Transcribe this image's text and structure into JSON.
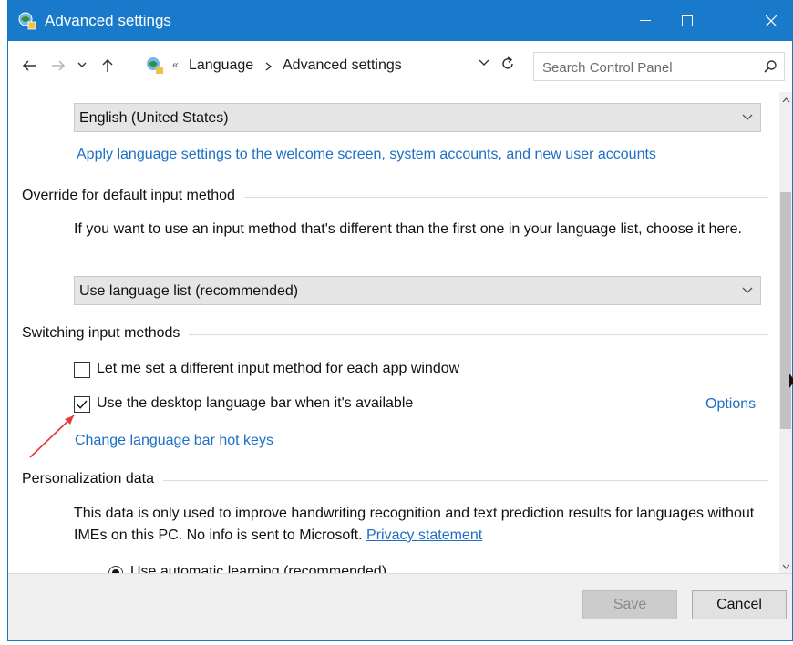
{
  "window": {
    "title": "Advanced settings"
  },
  "address": {
    "breadcrumb_sep": "«",
    "crumbs": [
      "Language",
      "Advanced settings"
    ],
    "search_placeholder": "Search Control Panel"
  },
  "content": {
    "language_select": {
      "value": "English (United States)"
    },
    "apply_link": "Apply language settings to the welcome screen, system accounts, and new user accounts",
    "override": {
      "heading": "Override for default input method",
      "description": "If you want to use an input method that's different than the first one in your language list, choose it here.",
      "select_value": "Use language list (recommended)"
    },
    "switching": {
      "heading": "Switching input methods",
      "option1": {
        "label": "Let me set a different input method for each app window",
        "checked": false
      },
      "option2": {
        "label": "Use the desktop language bar when it's available",
        "checked": true
      },
      "options_link": "Options",
      "hotkeys_link": "Change language bar hot keys"
    },
    "personalization": {
      "heading": "Personalization data",
      "description": "This data is only used to improve handwriting recognition and text prediction results for languages without IMEs on this PC. No info is sent to Microsoft.",
      "privacy_link": "Privacy statement",
      "radio1_label": "Use automatic learning (recommended)"
    }
  },
  "footer": {
    "save_label": "Save",
    "cancel_label": "Cancel"
  },
  "colors": {
    "titlebar": "#1979ca",
    "link": "#1e6fc4",
    "annotation_arrow": "#e53935"
  }
}
